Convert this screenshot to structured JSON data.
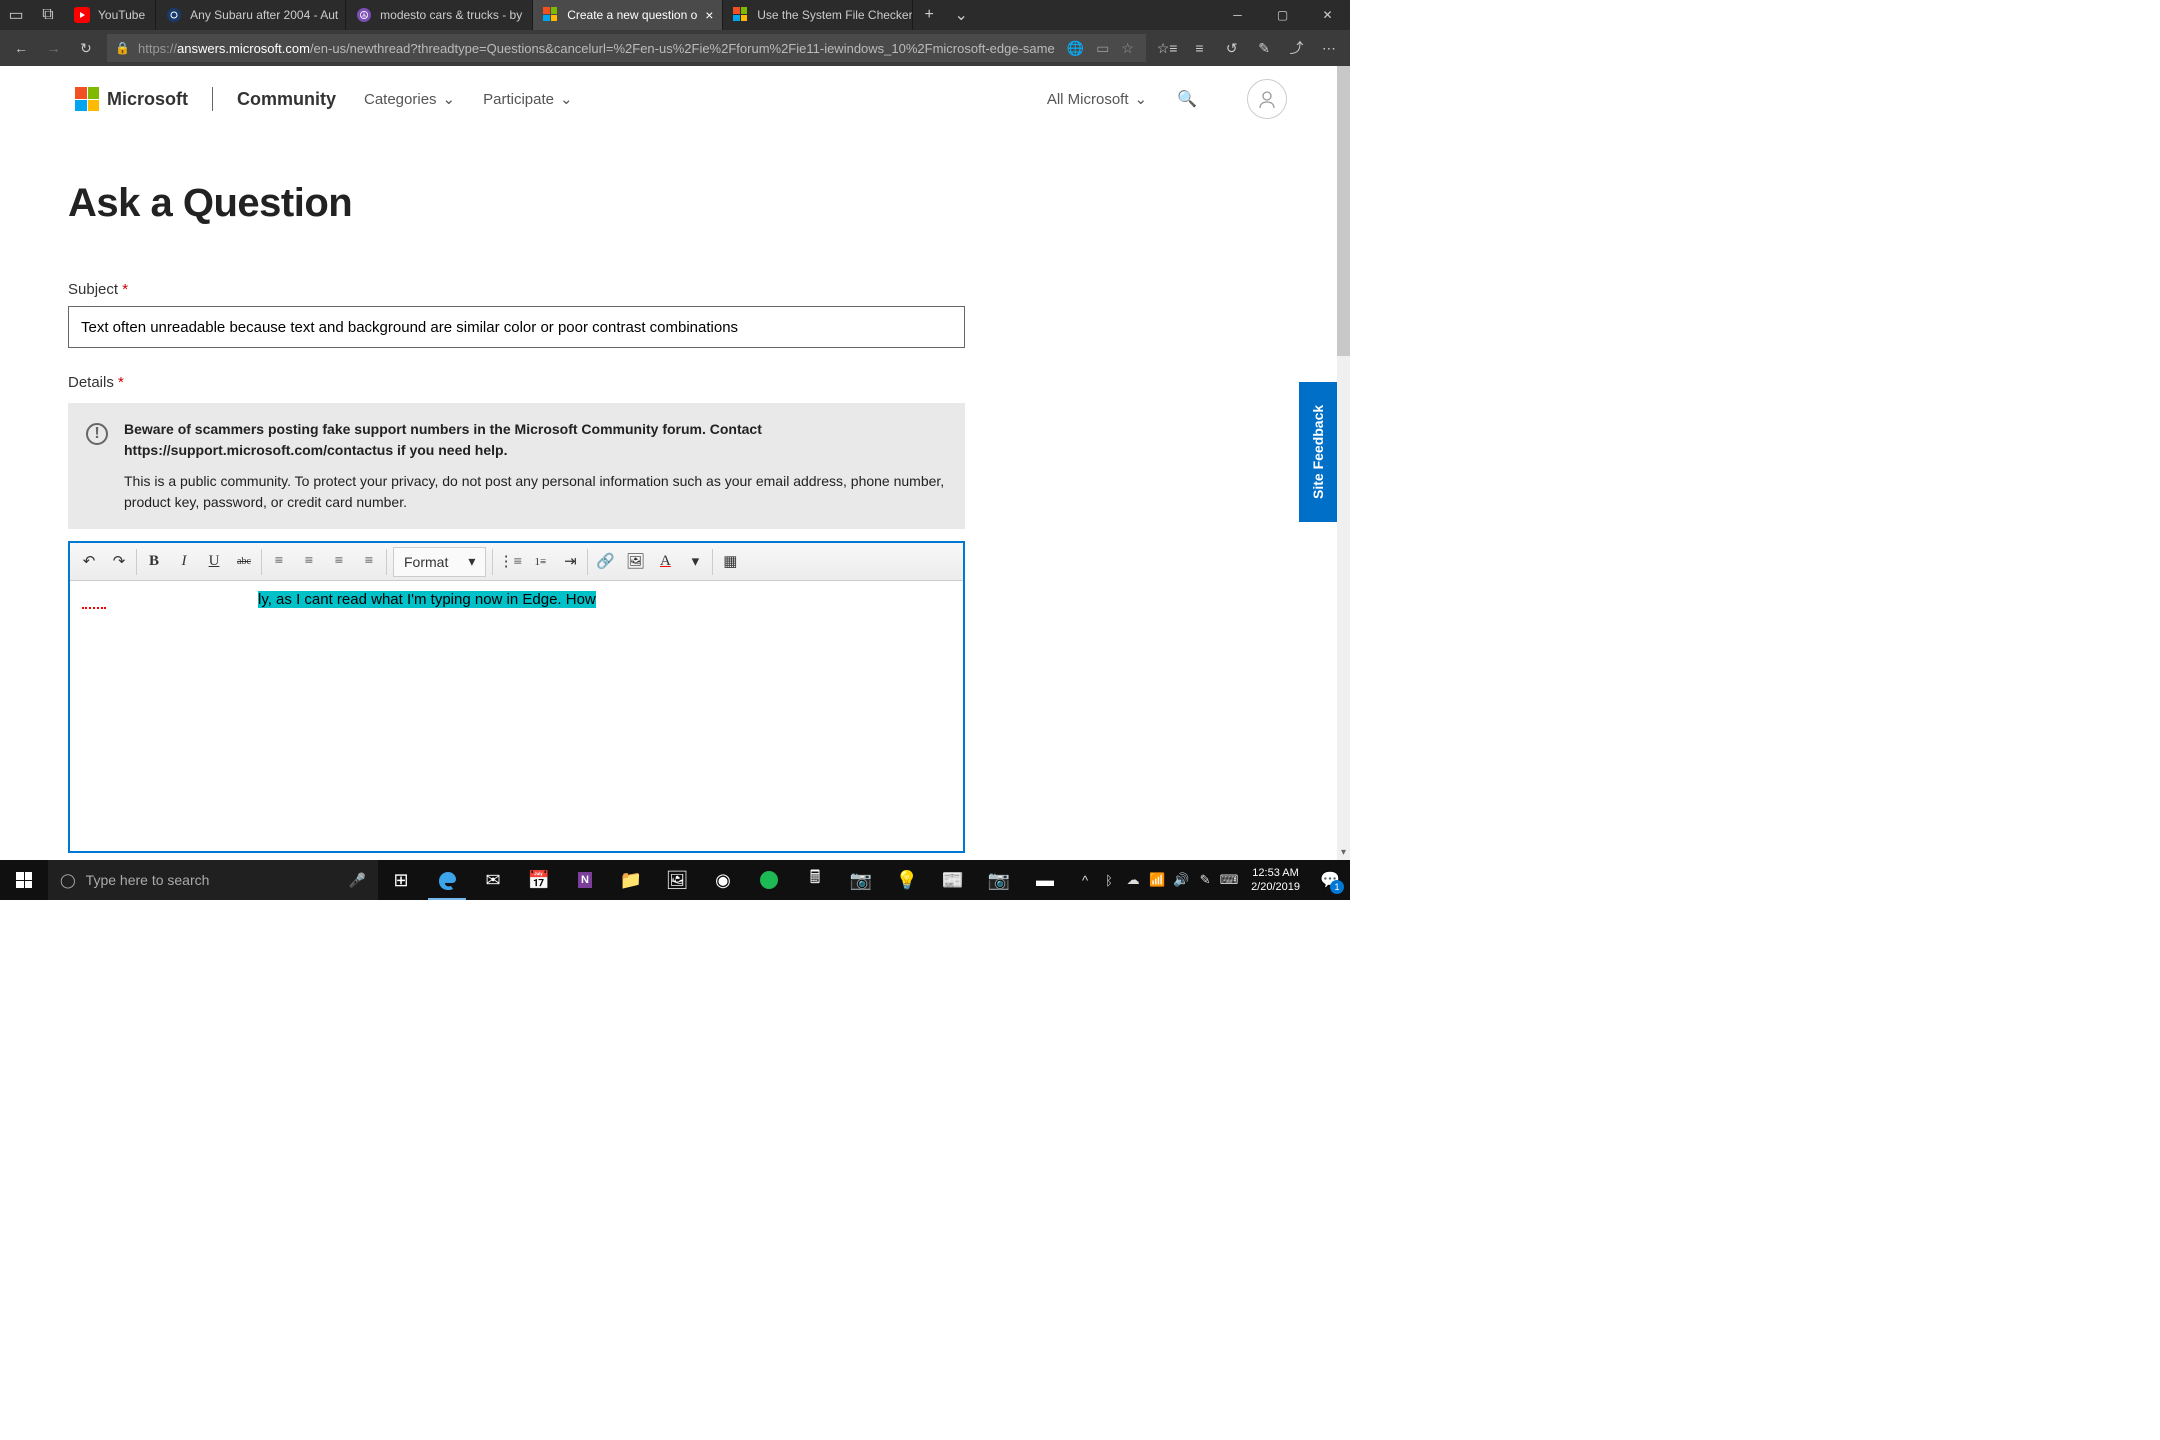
{
  "browser": {
    "tabs": [
      {
        "label": "YouTube",
        "favicon": "youtube"
      },
      {
        "label": "Any Subaru after 2004 - Aut",
        "favicon": "carsdirect"
      },
      {
        "label": "modesto cars & trucks - by",
        "favicon": "craigslist"
      },
      {
        "label": "Create a new question o",
        "favicon": "microsoft",
        "active": true
      },
      {
        "label": "Use the System File Checker",
        "favicon": "microsoft"
      }
    ],
    "url": {
      "host": "answers.microsoft.com",
      "path": "/en-us/newthread?threadtype=Questions&cancelurl=%2Fen-us%2Fie%2Fforum%2Fie11-iewindows_10%2Fmicrosoft-edge-same"
    }
  },
  "header": {
    "brand": "Microsoft",
    "site": "Community",
    "nav": [
      "Categories",
      "Participate"
    ],
    "right": "All Microsoft"
  },
  "page_title": "Ask a Question",
  "subject": {
    "label": "Subject",
    "value": "Text often unreadable because text and background are similar color or poor contrast combinations"
  },
  "details": {
    "label": "Details",
    "warning_line1": "Beware of scammers posting fake support numbers in the Microsoft Community forum. Contact https://support.microsoft.com/contactus if you need help.",
    "warning_line2": "This is a public community. To protect your privacy, do not post any personal information such as your email address, phone number, product key, password, or credit card number."
  },
  "toolbar": {
    "format_label": "Format"
  },
  "editor": {
    "highlighted_text": "ly, as I cant read what I'm typing now in Edge.  How"
  },
  "feedback_label": "Site Feedback",
  "taskbar": {
    "search_placeholder": "Type here to search",
    "time": "12:53 AM",
    "date": "2/20/2019",
    "notif_count": "1"
  }
}
